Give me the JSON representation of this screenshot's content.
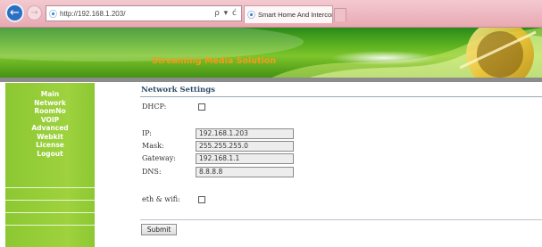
{
  "browser": {
    "back_glyph": "←",
    "forward_glyph": "→",
    "address": "http://192.168.1.203/",
    "address_tools": "ρ ▾ ć",
    "tab_title": "Smart Home And Intercom ...",
    "tab_close": "×",
    "icons": [
      "back-arrow-icon",
      "forward-arrow-icon",
      "ie-page-icon",
      "search-icon",
      "refresh-icon",
      "close-icon"
    ]
  },
  "banner": {
    "title": "Streaming Media Solution",
    "title_color": "#f49b1a"
  },
  "sidebar": {
    "items": [
      {
        "label": "Main"
      },
      {
        "label": "Network"
      },
      {
        "label": "RoomNo"
      },
      {
        "label": "VOIP"
      },
      {
        "label": "Advanced"
      },
      {
        "label": "Webkit"
      },
      {
        "label": "License"
      },
      {
        "label": "Logout"
      }
    ]
  },
  "page": {
    "title": "Network Settings",
    "dhcp_label": "DHCP:",
    "dhcp_checked": false,
    "ip_label": "IP:",
    "ip_value": "192.168.1.203",
    "mask_label": "Mask:",
    "mask_value": "255.255.255.0",
    "gateway_label": "Gateway:",
    "gateway_value": "192.168.1.1",
    "dns_label": "DNS:",
    "dns_value": "8.8.8.8",
    "ethwifi_label": "eth & wifi:",
    "ethwifi_checked": false,
    "submit_label": "Submit"
  },
  "colors": {
    "sidebar_green": "#9ed23e",
    "banner_green": "#55ad1f",
    "chrome_pink": "#e8a9b3",
    "title_blue": "#2c4a66"
  }
}
